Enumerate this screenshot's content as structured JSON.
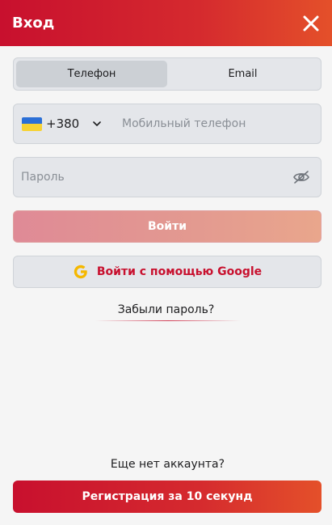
{
  "header": {
    "title": "Вход",
    "close_icon": "close-icon"
  },
  "tabs": [
    {
      "label": "Телефон",
      "active": true
    },
    {
      "label": "Email",
      "active": false
    }
  ],
  "phone": {
    "country_flag": "ukraine-flag-icon",
    "country_code": "+380",
    "placeholder": "Мобильный телефон",
    "value": ""
  },
  "password": {
    "placeholder": "Пароль",
    "value": "",
    "toggle_icon": "eye-off-icon"
  },
  "login_button": {
    "label": "Войти"
  },
  "google_button": {
    "label": "Войти с помощью Google",
    "icon": "google-icon"
  },
  "forgot_link": {
    "label": "Забыли пароль?"
  },
  "footer": {
    "no_account": "Еще нет аккаунта?",
    "register_label": "Регистрация за 10 секунд"
  },
  "colors": {
    "brand_red": "#c8102e",
    "brand_orange": "#e4502a",
    "field_bg": "#e4e6ea",
    "page_bg": "#f5f5f5"
  }
}
